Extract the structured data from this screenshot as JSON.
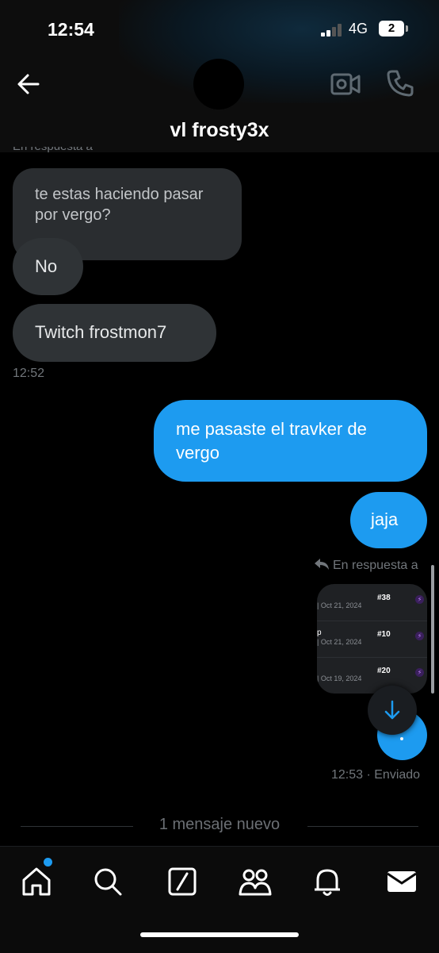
{
  "status_bar": {
    "time": "12:54",
    "network": "4G",
    "battery": "2"
  },
  "header": {
    "title": "vl frosty3x"
  },
  "conversation": {
    "top_reply_label": "En respuesta a",
    "incoming": [
      {
        "text": "te estas haciendo pasar por vergo?"
      },
      {
        "text": "No"
      },
      {
        "text": "Twitch frostmon7"
      }
    ],
    "incoming_time": "12:52",
    "outgoing": [
      {
        "text": "me pasaste el travker de vergo"
      },
      {
        "text": "jaja"
      }
    ],
    "reply_label": "En respuesta a",
    "attachment": {
      "rows": [
        {
          "prefix": "",
          "date": "| Oct 21, 2024",
          "rank": "#38"
        },
        {
          "prefix": "p",
          "date": "| Oct 21, 2024",
          "rank": "#10"
        },
        {
          "prefix": "",
          "date": "| Oct 19, 2024",
          "rank": "#20"
        }
      ]
    },
    "outgoing_time": "12:53 · Enviado",
    "new_messages": "1 mensaje nuevo"
  },
  "colors": {
    "accent": "#1d9bf0",
    "incoming_bubble": "#2f3336",
    "background": "#000000"
  },
  "nav": {
    "items": [
      "home-icon",
      "search-icon",
      "grok-icon",
      "communities-icon",
      "notifications-icon",
      "messages-icon"
    ]
  }
}
